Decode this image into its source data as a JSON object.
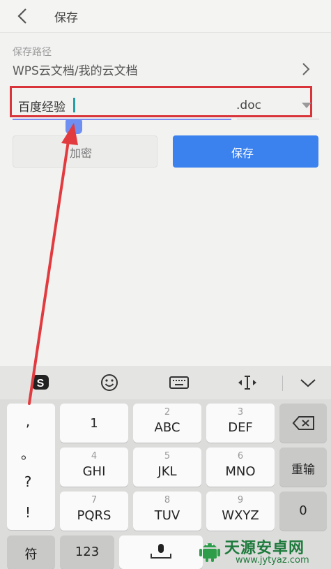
{
  "header": {
    "title": "保存",
    "back_icon": "chevron-left-icon"
  },
  "save_path": {
    "label": "保存路径",
    "value": "WPS云文档/我的云文档",
    "chevron_icon": "chevron-right-icon"
  },
  "filename": {
    "value": "百度经验",
    "extension": ".doc",
    "extension_dropdown_icon": "triangle-down-icon"
  },
  "buttons": {
    "encrypt": "加密",
    "save": "保存"
  },
  "keyboard": {
    "toolbar": [
      "sogou-logo-icon",
      "emoji-icon",
      "keyboard-icon",
      "cursor-icon",
      "collapse-icon"
    ],
    "punctuation": [
      ",",
      "。",
      "?",
      "!"
    ],
    "keys": [
      {
        "main": "1",
        "sub": ""
      },
      {
        "main": "ABC",
        "sub": "2"
      },
      {
        "main": "DEF",
        "sub": "3"
      },
      {
        "main": "GHI",
        "sub": "4"
      },
      {
        "main": "JKL",
        "sub": "5"
      },
      {
        "main": "MNO",
        "sub": "6"
      },
      {
        "main": "PQRS",
        "sub": "7"
      },
      {
        "main": "TUV",
        "sub": "8"
      },
      {
        "main": "WXYZ",
        "sub": "9"
      }
    ],
    "backspace_icon": "backspace-icon",
    "reenter": "重输",
    "zero": "0",
    "symbols": "符",
    "numbers": "123",
    "mic_icon": "microphone-icon"
  },
  "annotation": {
    "color": "#d9343a"
  },
  "watermark": {
    "name": "天源安卓网",
    "url": "www.jytyaz.com"
  },
  "colors": {
    "accent": "#3b82ee",
    "highlight_box": "#d9343a",
    "watermark": "#1e7a3c"
  }
}
